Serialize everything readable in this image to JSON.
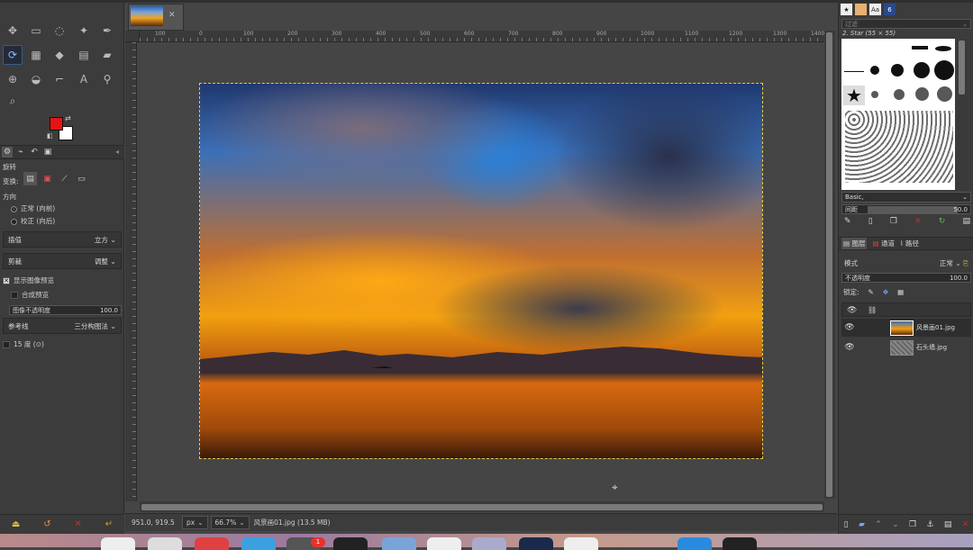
{
  "image_tab": {
    "close": "✕"
  },
  "ruler": {
    "labels": [
      "100",
      "0",
      "100",
      "200",
      "300",
      "400",
      "500",
      "600",
      "700",
      "800",
      "900",
      "1000",
      "1100",
      "1200",
      "1300",
      "1400"
    ]
  },
  "tool_options": {
    "title": "旋转",
    "transform_label": "变换:",
    "direction_label": "方向",
    "direction_normal": "正常 (向前)",
    "direction_corrective": "校正 (向后)",
    "interpolation_label": "插值",
    "interpolation_value": "立方",
    "clipping_label": "剪裁",
    "clipping_value": "调整",
    "show_preview": "显示图像预览",
    "composited_preview": "合成预览",
    "image_opacity_label": "图像不透明度",
    "image_opacity_value": "100.0",
    "guides_label": "参考线",
    "guides_value": "三分构图法",
    "angle_snap": "15 度 (⊙)"
  },
  "status": {
    "coords": "951.0, 919.5",
    "unit": "px",
    "zoom": "66.7%",
    "filename": "风景画01.jpg (13.5 MB)"
  },
  "brushes": {
    "filter_placeholder": "过滤",
    "current": "2. Star (55 × 55)",
    "set_name": "Basic,",
    "spacing_label": "间距",
    "spacing_value": "50.0"
  },
  "layers": {
    "tabs": [
      "图层",
      "通道",
      "路径"
    ],
    "mode_label": "模式",
    "mode_value": "正常",
    "opacity_label": "不透明度",
    "opacity_value": "100.0",
    "lock_label": "锁定:",
    "items": [
      {
        "name": "风景画01.jpg",
        "visible": true
      },
      {
        "name": "石头墙.jpg",
        "visible": true
      }
    ]
  },
  "dock": {
    "badge": "1"
  },
  "colors": {
    "foreground": "#e81313",
    "background": "#ffffff",
    "selection": "#e6c94a"
  }
}
